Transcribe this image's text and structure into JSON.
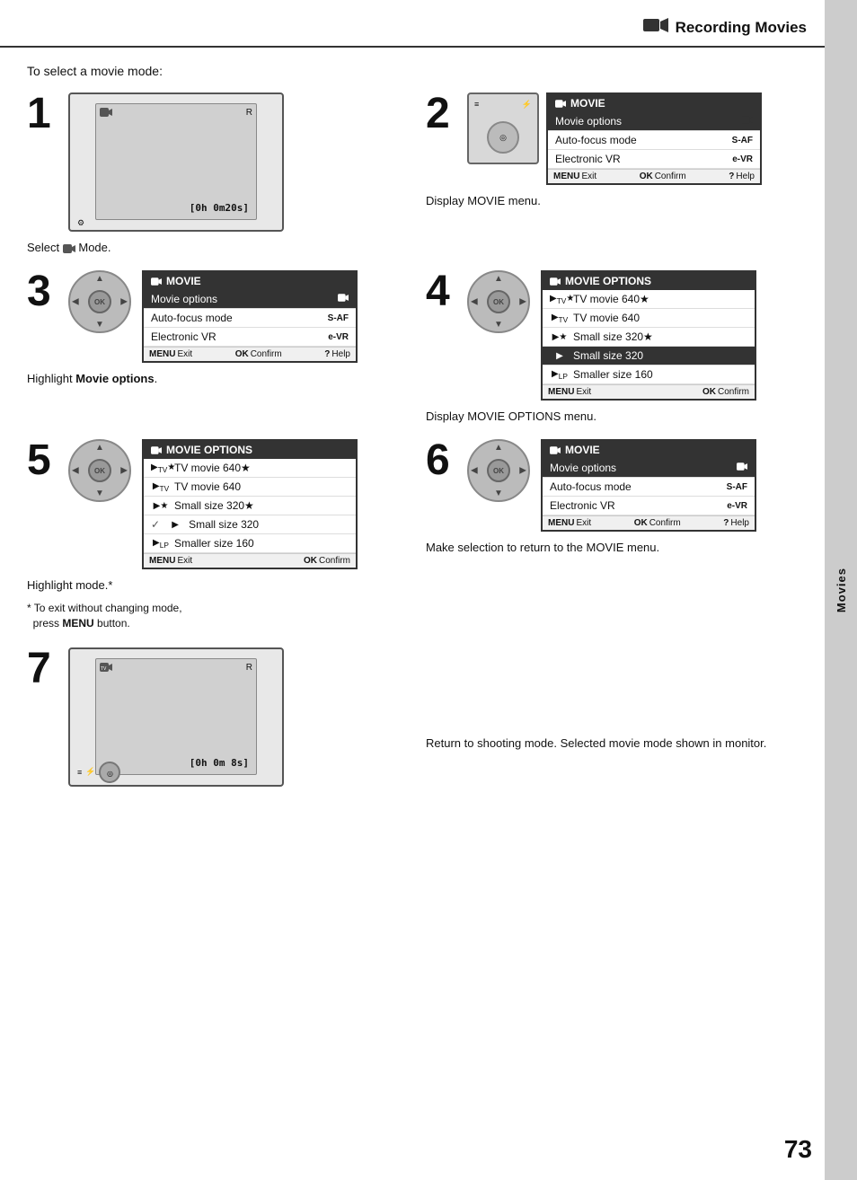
{
  "header": {
    "title": "Recording Movies",
    "icon": "movie-camera-icon"
  },
  "sidebar": {
    "label": "Movies"
  },
  "intro": "To select a movie mode:",
  "steps": [
    {
      "number": "1",
      "type": "camera",
      "caption": "Select  Mode.",
      "time_display": "[0h 0m20s]"
    },
    {
      "number": "2",
      "type": "menu",
      "menu_title": "MOVIE",
      "menu_rows": [
        {
          "label": "Movie options",
          "value": "",
          "highlighted": true
        },
        {
          "label": "Auto-focus mode",
          "value": "S-AF"
        },
        {
          "label": "Electronic VR",
          "value": "e-VR"
        }
      ],
      "footer": [
        "MENU Exit",
        "OK Confirm",
        "? Help"
      ],
      "caption": "Display MOVIE menu."
    },
    {
      "number": "3",
      "type": "dpad+menu",
      "menu_title": "MOVIE",
      "menu_rows": [
        {
          "label": "Movie options",
          "value": "",
          "highlighted": true
        },
        {
          "label": "Auto-focus mode",
          "value": "S-AF"
        },
        {
          "label": "Electronic VR",
          "value": "e-VR"
        }
      ],
      "footer": [
        "MENU Exit",
        "OK Confirm",
        "? Help"
      ],
      "caption": "Highlight <b>Movie options</b>."
    },
    {
      "number": "4",
      "type": "dpad+menu",
      "menu_title": "MOVIE OPTIONS",
      "menu_rows": [
        {
          "label": "TV movie 640★",
          "icon": "tv-hq",
          "highlighted": false
        },
        {
          "label": "TV movie 640",
          "icon": "tv",
          "highlighted": false
        },
        {
          "label": "Small size 320★",
          "icon": "sm-hq",
          "highlighted": false
        },
        {
          "label": "Small size 320",
          "icon": "sm",
          "highlighted": true,
          "selected": true
        },
        {
          "label": "Smaller size 160",
          "icon": "sm-lp",
          "highlighted": false
        }
      ],
      "footer": [
        "MENU Exit",
        "OK Confirm"
      ],
      "caption": "Display MOVIE OPTIONS menu."
    },
    {
      "number": "5",
      "type": "dpad+menu",
      "menu_title": "MOVIE OPTIONS",
      "menu_rows": [
        {
          "label": "TV movie 640★",
          "icon": "tv-hq",
          "highlighted": false
        },
        {
          "label": "TV movie 640",
          "icon": "tv",
          "highlighted": false
        },
        {
          "label": "Small size 320★",
          "icon": "sm-hq",
          "highlighted": false
        },
        {
          "label": "Small size 320",
          "icon": "sm",
          "highlighted": false,
          "check": true
        },
        {
          "label": "Smaller size 160",
          "icon": "sm-lp",
          "highlighted": false
        }
      ],
      "footer": [
        "MENU Exit",
        "OK Confirm"
      ],
      "caption": "Highlight mode.*",
      "note": "* To exit without changing mode,\n  press MENU button."
    },
    {
      "number": "6",
      "type": "dpad+menu",
      "menu_title": "MOVIE",
      "menu_rows": [
        {
          "label": "Movie options",
          "value": "",
          "highlighted": true
        },
        {
          "label": "Auto-focus mode",
          "value": "S-AF"
        },
        {
          "label": "Electronic VR",
          "value": "e-VR"
        }
      ],
      "footer": [
        "MENU Exit",
        "OK Confirm",
        "? Help"
      ],
      "caption": "Make selection to return to the MOVIE menu."
    },
    {
      "number": "7",
      "type": "camera2",
      "caption": "Return to shooting mode. Selected movie mode shown in monitor.",
      "time_display": "[0h 0m 8s]"
    }
  ],
  "page_number": "73"
}
